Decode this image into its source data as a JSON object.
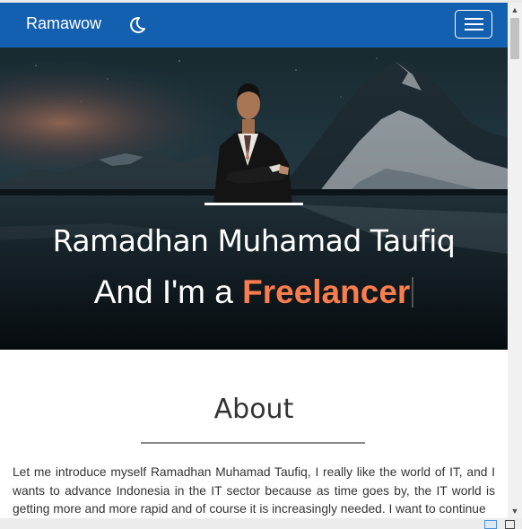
{
  "navbar": {
    "brand": "Ramawow",
    "theme_toggle_icon": "moon-icon",
    "menu_icon": "hamburger-menu-icon",
    "background_color": "#1460b0"
  },
  "hero": {
    "name": "Ramadhan Muhamad Taufiq",
    "role_prefix": "And I'm a ",
    "role_highlight": "Freelancer",
    "accent_color": "#fb7c4c"
  },
  "about": {
    "title": "About",
    "text": "Let me introduce myself Ramadhan Muhamad Taufiq, I really like the world of IT, and I wants to advance Indonesia in the IT sector because as time goes by, the IT world is getting more and more rapid and of course it is increasingly needed. I want to continue"
  }
}
